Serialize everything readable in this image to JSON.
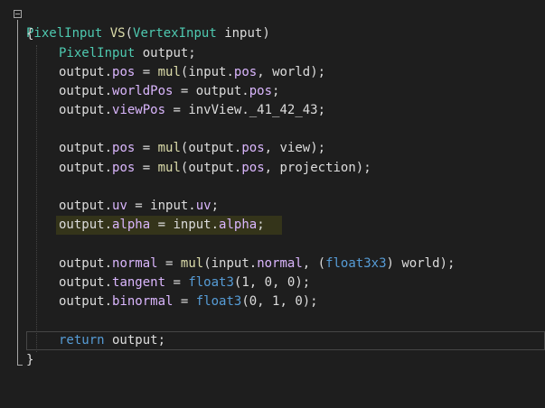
{
  "editor": {
    "lines": {
      "l0": {
        "type": "PixelInput",
        "space1": " ",
        "fn": "VS",
        "open": "(",
        "ptype": "VertexInput",
        "space2": " ",
        "param": "input",
        "close": ")"
      },
      "l1": "{",
      "l2": {
        "type": "PixelInput",
        "rest": " output;"
      },
      "l3": {
        "a": "output.",
        "m": "pos",
        "b": " = ",
        "fn": "mul",
        "c": "(input.",
        "m2": "pos",
        "d": ", world);"
      },
      "l4": {
        "a": "output.",
        "m": "worldPos",
        "b": " = output.",
        "m2": "pos",
        "c": ";"
      },
      "l5": {
        "a": "output.",
        "m": "viewPos",
        "b": " = invView._41_42_43;"
      },
      "l6": {
        "a": "output.",
        "m": "pos",
        "b": " = ",
        "fn": "mul",
        "c": "(output.",
        "m2": "pos",
        "d": ", view);"
      },
      "l7": {
        "a": "output.",
        "m": "pos",
        "b": " = ",
        "fn": "mul",
        "c": "(output.",
        "m2": "pos",
        "d": ", projection);"
      },
      "l8": {
        "a": "output.",
        "m": "uv",
        "b": " = input.",
        "m2": "uv",
        "c": ";"
      },
      "l9": {
        "a": "output.",
        "m": "alpha",
        "b": " = input.",
        "m2": "alpha",
        "c": ";"
      },
      "l10": {
        "a": "output.",
        "m": "normal",
        "b": " = ",
        "fn": "mul",
        "c": "(input.",
        "m2": "normal",
        "d": ", (",
        "t": "float3x3",
        "e": ") world);"
      },
      "l11": {
        "a": "output.",
        "m": "tangent",
        "b": " = ",
        "t": "float3",
        "c": "(1, 0, 0);"
      },
      "l12": {
        "a": "output.",
        "m": "binormal",
        "b": " = ",
        "t": "float3",
        "c": "(0, 1, 0);"
      },
      "l13": {
        "kw": "return",
        "rest": " output;"
      },
      "l14": "}"
    }
  },
  "colors": {
    "background": "#1e1e1e",
    "keyword": "#569cd6",
    "function": "#dcdcaa",
    "member": "#dab6fd",
    "type": "#4ec9b0",
    "text": "#dcdcdc",
    "highlight": "#ffff00"
  }
}
